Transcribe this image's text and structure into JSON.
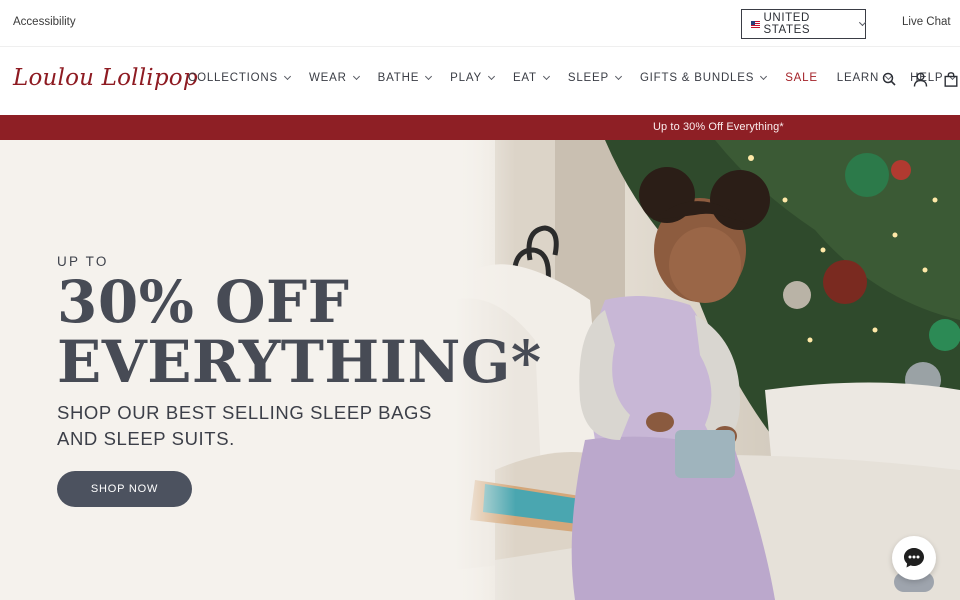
{
  "utility_bar": {
    "accessibility_label": "Accessibility",
    "country_label": "UNITED STATES",
    "live_chat_label": "Live Chat"
  },
  "header": {
    "logo_text": "Loulou Lollipop",
    "nav": [
      {
        "label": "COLLECTIONS",
        "has_dropdown": true
      },
      {
        "label": "WEAR",
        "has_dropdown": true
      },
      {
        "label": "BATHE",
        "has_dropdown": true
      },
      {
        "label": "PLAY",
        "has_dropdown": true
      },
      {
        "label": "EAT",
        "has_dropdown": true
      },
      {
        "label": "SLEEP",
        "has_dropdown": true
      },
      {
        "label": "GIFTS & BUNDLES",
        "has_dropdown": true
      },
      {
        "label": "SALE",
        "has_dropdown": false
      },
      {
        "label": "LEARN",
        "has_dropdown": true
      },
      {
        "label": "HELP",
        "has_dropdown": true
      }
    ],
    "icons": [
      "search-icon",
      "account-icon",
      "cart-icon"
    ]
  },
  "promo_banner": {
    "text": "Up to 30% Off Everything*"
  },
  "hero": {
    "eyebrow": "UP TO",
    "headline_line1": "30% OFF",
    "headline_line2": "EVERYTHING*",
    "subline_line1": "SHOP OUR BEST SELLING SLEEP BAGS",
    "subline_line2": "AND SLEEP SUITS.",
    "cta_label": "SHOP NOW"
  },
  "colors": {
    "brand_red": "#8e1b22",
    "promo_bg": "#8e1f25",
    "hero_bg": "#f5f2ed",
    "button_bg": "#4c525f",
    "text_dark": "#3a3d45"
  }
}
